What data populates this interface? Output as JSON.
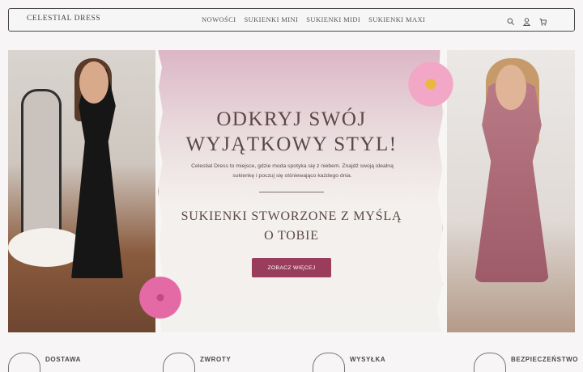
{
  "header": {
    "logo": "CELESTIAL DRESS",
    "nav": [
      "NOWOŚCI",
      "SUKIENKI MINI",
      "SUKIENKI MIDI",
      "SUKIENKI MAXI"
    ],
    "icons": [
      "search-icon",
      "user-icon",
      "cart-icon"
    ]
  },
  "hero": {
    "title_line1": "ODKRYJ SWÓJ",
    "title_line2": "WYJĄTKOWY STYL!",
    "text_line1": "Celestial Dress to miejsce, gdzie moda spotyka  się z niebem. Znajdź swoją idealną",
    "text_line2": "sukienkę  i poczuj się olśniewająco każdego dnia.",
    "subtitle_line1": "SUKIENKI STWORZONE Z MYŚLĄ",
    "subtitle_line2": "O TOBIE",
    "cta": "ZOBACZ WIĘCEJ"
  },
  "features": [
    {
      "label": "DOSTAWA",
      "icon": "delivery-icon"
    },
    {
      "label": "ZWROTY",
      "icon": "returns-icon"
    },
    {
      "label": "WYSYŁKA",
      "icon": "shipping-icon"
    },
    {
      "label": "BEZPIECZEŃSTWO",
      "icon": "security-icon"
    }
  ],
  "colors": {
    "accent": "#9a3d5c",
    "background": "#f7f5f5",
    "text": "#5a4848"
  }
}
